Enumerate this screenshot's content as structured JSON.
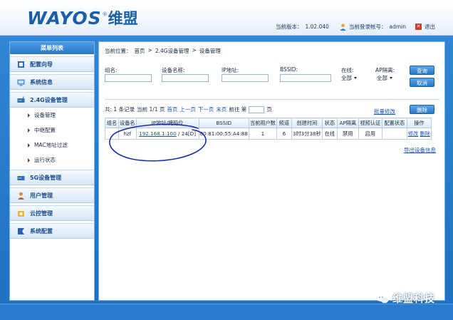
{
  "header": {
    "logo_text": "WAYOS",
    "logo_cn": "维盟",
    "version_label": "当前版本：",
    "version_value": "1.02.040",
    "user_label": "当前登录帐号：",
    "user_value": "admin",
    "logout_label": "退出"
  },
  "sidebar": {
    "title": "菜单列表",
    "groups": [
      {
        "label": "配置向导",
        "icon": "wizard-icon"
      },
      {
        "label": "系统信息",
        "icon": "info-icon"
      },
      {
        "label": "2.4G设备管理",
        "icon": "device-icon"
      },
      {
        "label": "5G设备管理",
        "icon": "device-5g-icon"
      },
      {
        "label": "用户管理",
        "icon": "user-icon"
      },
      {
        "label": "云控管理",
        "icon": "cloud-icon"
      },
      {
        "label": "系统配置",
        "icon": "settings-icon"
      }
    ],
    "submenu": [
      "设备管理",
      "中继配置",
      "MAC地址过滤",
      "运行状态"
    ]
  },
  "breadcrumb": {
    "prefix": "当前位置：",
    "items": [
      "首页",
      "2.4G设备管理",
      "设备管理"
    ],
    "sep": ">"
  },
  "filters": {
    "group_label": "组名:",
    "device_label": "设备名称:",
    "ip_label": "IP地址:",
    "bssid_label": "BSSID:",
    "online_label": "在线:",
    "online_value": "全部",
    "ap_isolation_label": "AP隔离:",
    "ap_isolation_value": "全部",
    "query_button": "查询",
    "cancel_button": "取消"
  },
  "pager": {
    "total": "共: 1 条记录",
    "current": "当前 1/1 页",
    "first": "首页",
    "prev": "上一页",
    "next": "下一页",
    "last": "末页",
    "goto_prefix": "前往 第",
    "goto_suffix": "页",
    "batch_edit": "批量修改",
    "delete_button": "删除",
    "export": "导出设备信息"
  },
  "table": {
    "headers": [
      "组名",
      "设备名",
      "IP地址/掩码位",
      "BSSID",
      "当前用户数",
      "频道",
      "创建时间",
      "状态",
      "AP隔离",
      "视频认证",
      "配置状态",
      "操作"
    ],
    "row": {
      "group": "",
      "device": "hzf",
      "ip": "192.168.1.100",
      "mask": "/ 24[D]",
      "bssid": "80:81:00:55:A4:88",
      "users": "1",
      "channel": "6",
      "created": "3时3分38秒",
      "status": "在线",
      "ap_isolation": "禁用",
      "auth": "启用",
      "config_status": "",
      "op_edit": "修改",
      "op_delete": "删除"
    }
  },
  "watermark": {
    "text": "维盟科技"
  },
  "colors": {
    "brand": "#1a5fa8",
    "frame": "#2a7ad0",
    "link": "#1a52b8",
    "annotation": "#1c2fa8"
  }
}
